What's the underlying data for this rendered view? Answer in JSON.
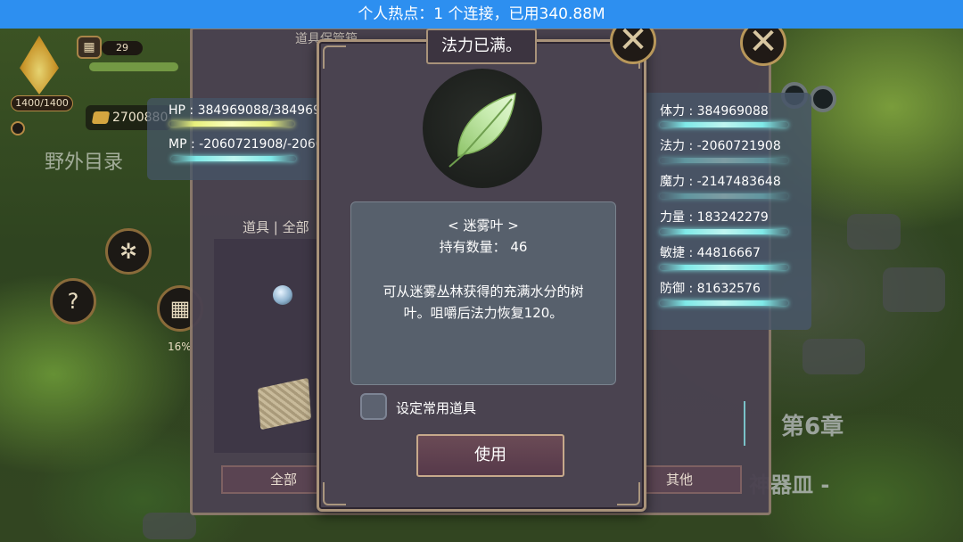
{
  "status_bar": {
    "hotspot_text": "个人热点：1 个连接，已用340.88M"
  },
  "hud": {
    "hp_text": "1400/1400",
    "level": "29",
    "gold": "2700880",
    "field_directory": "野外目录",
    "help_glyph": "?",
    "progress_text": "16%",
    "chapter_text": "第6章",
    "chapter_sub_text": "神器皿 -"
  },
  "inventory": {
    "title": "道具保管箱",
    "category_label": "道具 | 全部",
    "bottom_tabs": [
      "全部",
      "其他"
    ]
  },
  "hp_mp": {
    "hp": "HP : 384969088/384969088",
    "mp": "MP : -2060721908/-2060721908"
  },
  "attributes": [
    {
      "label": "体力 : 384969088"
    },
    {
      "label": "法力 : -2060721908"
    },
    {
      "label": "魔力 : -2147483648"
    },
    {
      "label": "力量 : 183242279"
    },
    {
      "label": "敏捷 : 44816667"
    },
    {
      "label": "防御 : 81632576"
    }
  ],
  "popup": {
    "title": "法力已满。",
    "item_name": "< 迷雾叶 >",
    "quantity_label": "持有数量： 46",
    "description_line1": "可从迷雾丛林获得的充满水分的树",
    "description_line2": "叶。咀嚼后法力恢复120。",
    "favorite_label": "设定常用道具",
    "use_label": "使用",
    "close_glyph": "✕"
  },
  "icons": {
    "item": "leaf-icon",
    "close": "close-icon",
    "settings": "gear-icon",
    "calendar": "calendar-icon",
    "help": "help-icon",
    "gold": "gold-icon"
  }
}
